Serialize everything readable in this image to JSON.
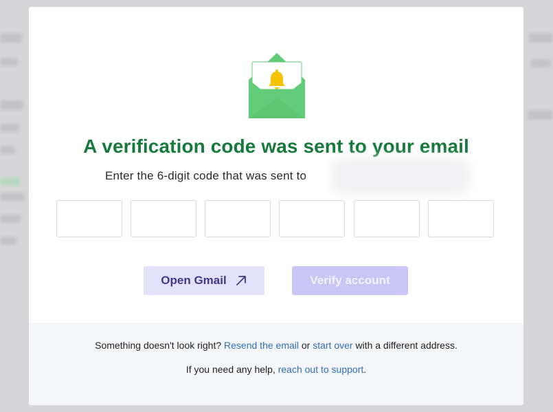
{
  "title": "A verification code was sent to your email",
  "subtitle": "Enter the 6-digit code that was sent to",
  "code_inputs": [
    "",
    "",
    "",
    "",
    "",
    ""
  ],
  "buttons": {
    "open_gmail": "Open Gmail",
    "open_gmail_icon": "arrow-up-right-icon",
    "verify": "Verify account"
  },
  "footer": {
    "line1_prefix": "Something doesn't look right? ",
    "resend_link": "Resend the email",
    "line1_or": " or ",
    "start_over_link": "start over",
    "line1_suffix": " with a different address.",
    "line2_prefix": "If you need any help, ",
    "support_link": "reach out to support",
    "line2_suffix": "."
  },
  "colors": {
    "title_green": "#157a3b",
    "envelope_green": "#62cc7a",
    "bell_yellow": "#f5c400",
    "link_blue": "#2f6fb5",
    "primary_light": "#c9c5f5",
    "secondary_light": "#e4e2fb"
  },
  "icons": {
    "envelope": "envelope-open-icon",
    "bell": "bell-icon"
  }
}
